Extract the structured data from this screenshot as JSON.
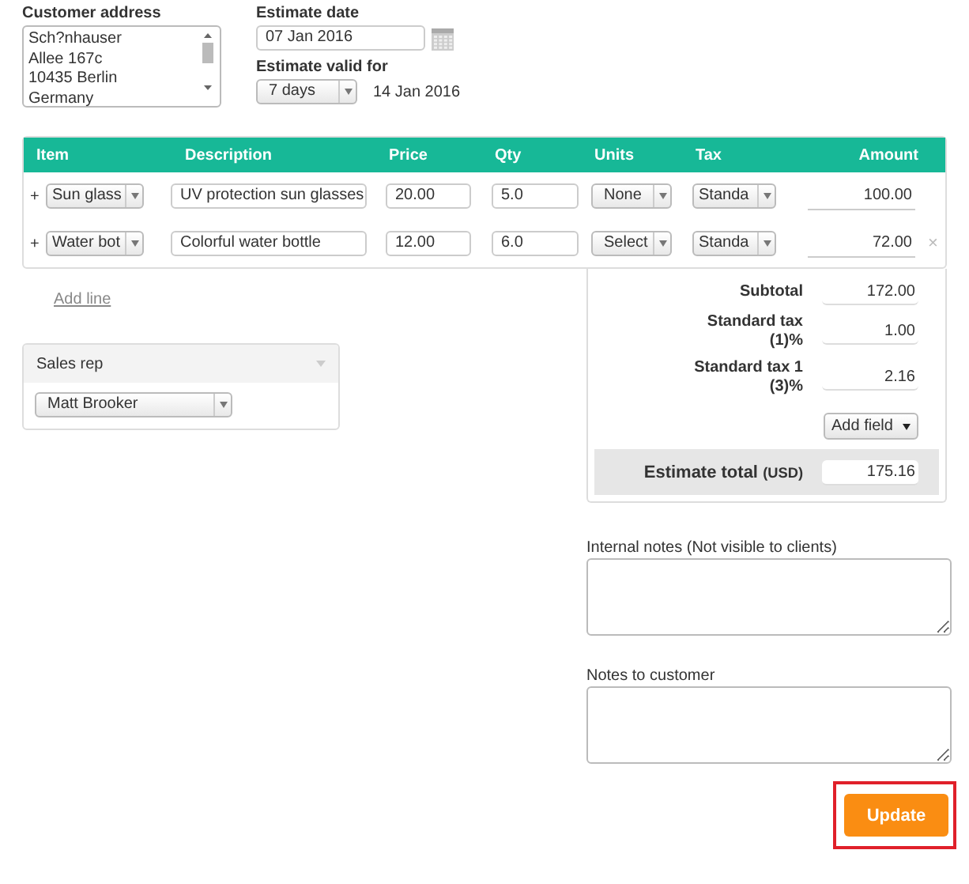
{
  "customer_address": {
    "label": "Customer address",
    "lines": [
      "Sch?nhauser",
      "Allee 167c",
      "10435 Berlin",
      "Germany"
    ]
  },
  "estimate_date": {
    "label": "Estimate date",
    "value": "07 Jan 2016"
  },
  "valid_for": {
    "label": "Estimate valid for",
    "value": "7 days",
    "until": "14 Jan 2016"
  },
  "table": {
    "columns": [
      "Item",
      "Description",
      "Price",
      "Qty",
      "Units",
      "Tax",
      "Amount"
    ],
    "rows": [
      {
        "add": "+",
        "item": "Sun glass",
        "description": "UV protection sun glasses",
        "price": "20.00",
        "qty": "5.0",
        "units": "None",
        "tax": "Standa",
        "amount": "100.00"
      },
      {
        "add": "+",
        "item": "Water bot",
        "description": "Colorful water bottle",
        "price": "12.00",
        "qty": "6.0",
        "units": "Select",
        "tax": "Standa",
        "amount": "72.00",
        "remove": "×"
      }
    ]
  },
  "add_line": "Add line",
  "sales_rep": {
    "title": "Sales rep",
    "value": "Matt Brooker"
  },
  "totals": [
    {
      "label": "Subtotal",
      "value": "172.00"
    },
    {
      "label": "Standard tax (1)%",
      "value": "1.00"
    },
    {
      "label": "Standard tax 1 (3)%",
      "value": "2.16"
    }
  ],
  "add_field": "Add field",
  "estimate_total": {
    "label": "Estimate total",
    "currency": "(USD)",
    "value": "175.16"
  },
  "internal_notes": {
    "label": "Internal notes (Not visible to clients)"
  },
  "notes_to_customer": {
    "label": "Notes to customer"
  },
  "update_button": {
    "label": "Update",
    "highlighted": true
  }
}
